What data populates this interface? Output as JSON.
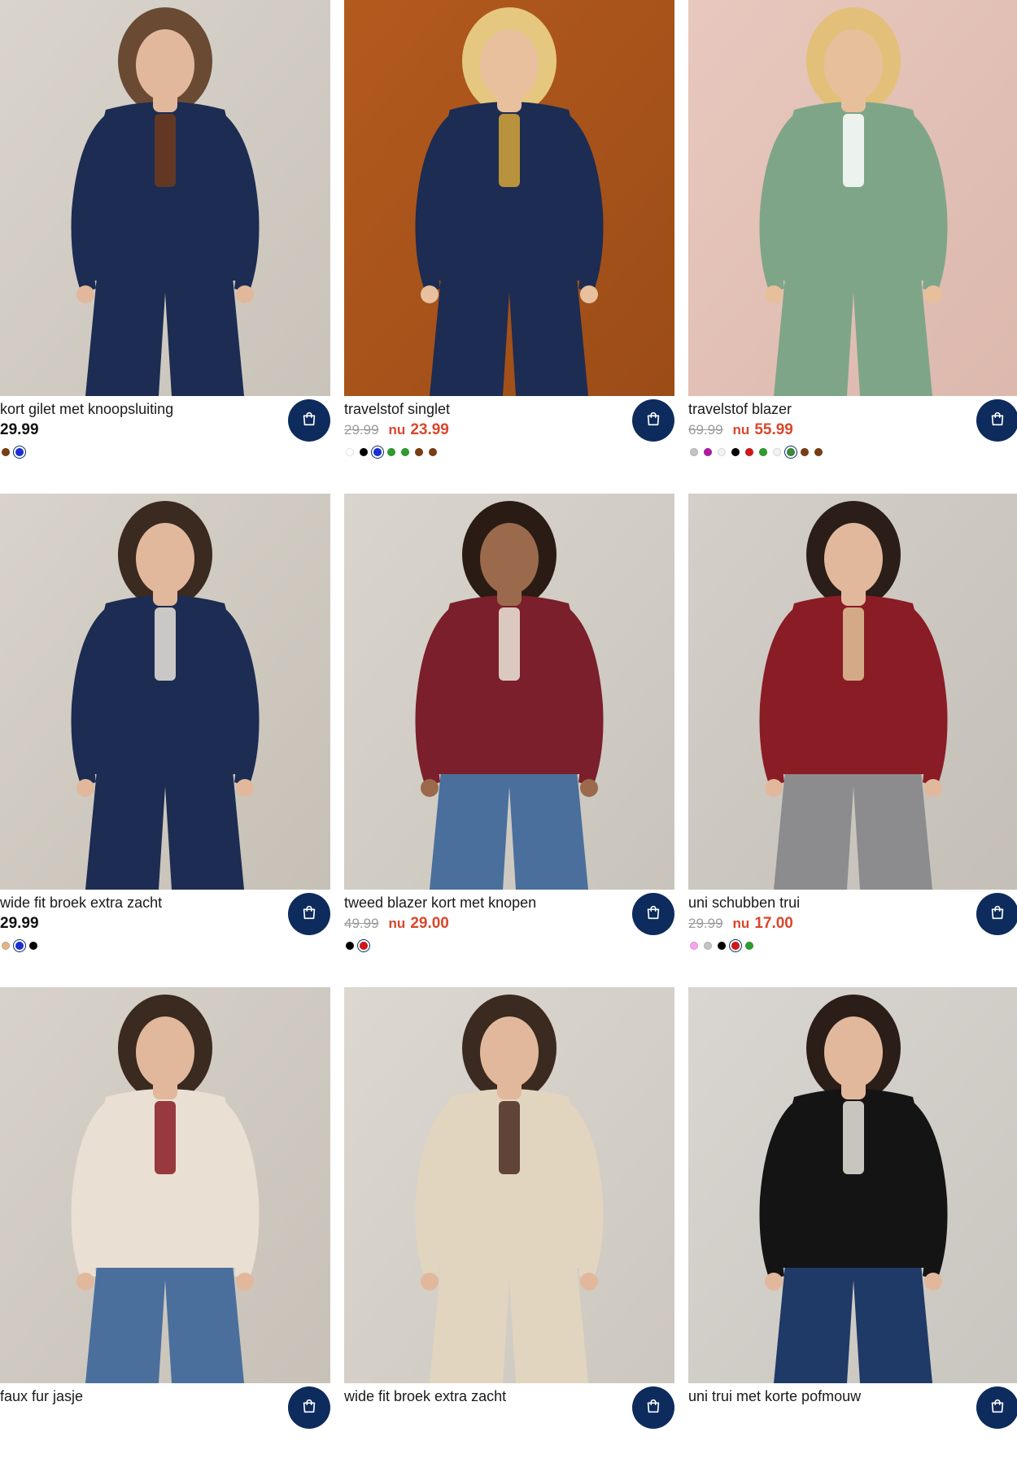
{
  "products": [
    {
      "title": "kort gilet met knoopsluiting",
      "price": "29.99",
      "old_price": null,
      "sale_prefix": null,
      "swatches": [
        {
          "color": "#7a3e12"
        },
        {
          "color": "#1a2ed8",
          "selected": true
        }
      ],
      "image": {
        "bg": "#d9d4cc",
        "bg2": "#c9c3ba",
        "skin": "#e2b89c",
        "hair": "#6b4a33",
        "top": "#1d2c52",
        "bottom": "#1d2c52",
        "accent": "#6e3b1c"
      }
    },
    {
      "title": "travelstof singlet",
      "price": null,
      "old_price": "29.99",
      "sale_prefix": "nu",
      "sale_price": "23.99",
      "swatches": [
        {
          "color": "#ffffff"
        },
        {
          "color": "#000000"
        },
        {
          "color": "#1a2ed8",
          "selected": true
        },
        {
          "color": "#2e9e2e"
        },
        {
          "color": "#2e9e2e"
        },
        {
          "color": "#7a3e12"
        },
        {
          "color": "#7a3e12"
        }
      ],
      "image": {
        "bg": "#b35a1e",
        "bg2": "#9c4c17",
        "skin": "#e8c09e",
        "hair": "#e6c77f",
        "top": "#1d2c52",
        "bottom": "#1d2c52",
        "accent": "#d4a438"
      }
    },
    {
      "title": "travelstof blazer",
      "price": null,
      "old_price": "69.99",
      "sale_prefix": "nu",
      "sale_price": "55.99",
      "swatches": [
        {
          "color": "#c4c4c4"
        },
        {
          "color": "#b01aa6"
        },
        {
          "color": "#f2f2f2"
        },
        {
          "color": "#000000"
        },
        {
          "color": "#d41616"
        },
        {
          "color": "#2e9e2e"
        },
        {
          "color": "#f2f2f2"
        },
        {
          "color": "#3a8a3a",
          "selected": true
        },
        {
          "color": "#7a3e12"
        },
        {
          "color": "#7a3e12"
        }
      ],
      "image": {
        "bg": "#e8c8be",
        "bg2": "#dcb8ad",
        "skin": "#e8bf9b",
        "hair": "#e3c07a",
        "top": "#7fa589",
        "bottom": "#7fa589",
        "accent": "#ffffff"
      }
    },
    {
      "title": "wide fit broek extra zacht",
      "price": "29.99",
      "old_price": null,
      "sale_prefix": null,
      "swatches": [
        {
          "color": "#e3b58c"
        },
        {
          "color": "#1a2ed8",
          "selected": true
        },
        {
          "color": "#000000"
        }
      ],
      "image": {
        "bg": "#d8d3cb",
        "bg2": "#c6c0b6",
        "skin": "#e2b89c",
        "hair": "#3a2a20",
        "top": "#1d2c52",
        "bottom": "#1d2c52",
        "accent": "#e8e4dc"
      }
    },
    {
      "title": "tweed blazer kort met knopen",
      "price": null,
      "old_price": "49.99",
      "sale_prefix": "nu",
      "sale_price": "29.00",
      "swatches": [
        {
          "color": "#000000"
        },
        {
          "color": "#d41616",
          "selected": true
        }
      ],
      "image": {
        "bg": "#d9d5ce",
        "bg2": "#c9c4bb",
        "skin": "#9b6a4c",
        "hair": "#2a1c14",
        "top": "#7a1f2b",
        "bottom": "#4a6f9c",
        "accent": "#ece6dc"
      }
    },
    {
      "title": "uni schubben trui",
      "price": null,
      "old_price": "29.99",
      "sale_prefix": "nu",
      "sale_price": "17.00",
      "swatches": [
        {
          "color": "#f4a6e8"
        },
        {
          "color": "#c4c4c4"
        },
        {
          "color": "#000000"
        },
        {
          "color": "#d41616",
          "selected": true
        },
        {
          "color": "#2e9e2e"
        }
      ],
      "image": {
        "bg": "#d4d0c9",
        "bg2": "#c4bfb7",
        "skin": "#e2b89c",
        "hair": "#2b1d17",
        "top": "#8a1c25",
        "bottom": "#8c8c8e",
        "accent": "#e0c29a"
      }
    },
    {
      "title": "faux fur jasje",
      "price": null,
      "old_price": null,
      "sale_prefix": null,
      "swatches": [],
      "image": {
        "bg": "#d7d2ca",
        "bg2": "#c7c1b8",
        "skin": "#e2b89c",
        "hair": "#3a2a20",
        "top": "#e9dfd2",
        "bottom": "#4a6f9c",
        "accent": "#8a1c25"
      }
    },
    {
      "title": "wide fit broek extra zacht",
      "price": null,
      "old_price": null,
      "sale_prefix": null,
      "swatches": [],
      "image": {
        "bg": "#dcd8d1",
        "bg2": "#ccc7bf",
        "skin": "#e2b89c",
        "hair": "#3a2a20",
        "top": "#e2d5bf",
        "bottom": "#e2d5bf",
        "accent": "#4a2a20"
      }
    },
    {
      "title": "uni trui met korte pofmouw",
      "price": null,
      "old_price": null,
      "sale_prefix": null,
      "swatches": [],
      "image": {
        "bg": "#d9d6d1",
        "bg2": "#c9c6c0",
        "skin": "#e2b89c",
        "hair": "#2b1d17",
        "top": "#141414",
        "bottom": "#1f3a66",
        "accent": "#e8e4dc"
      }
    }
  ],
  "icons": {
    "cart": "shopping-bag-icon"
  }
}
